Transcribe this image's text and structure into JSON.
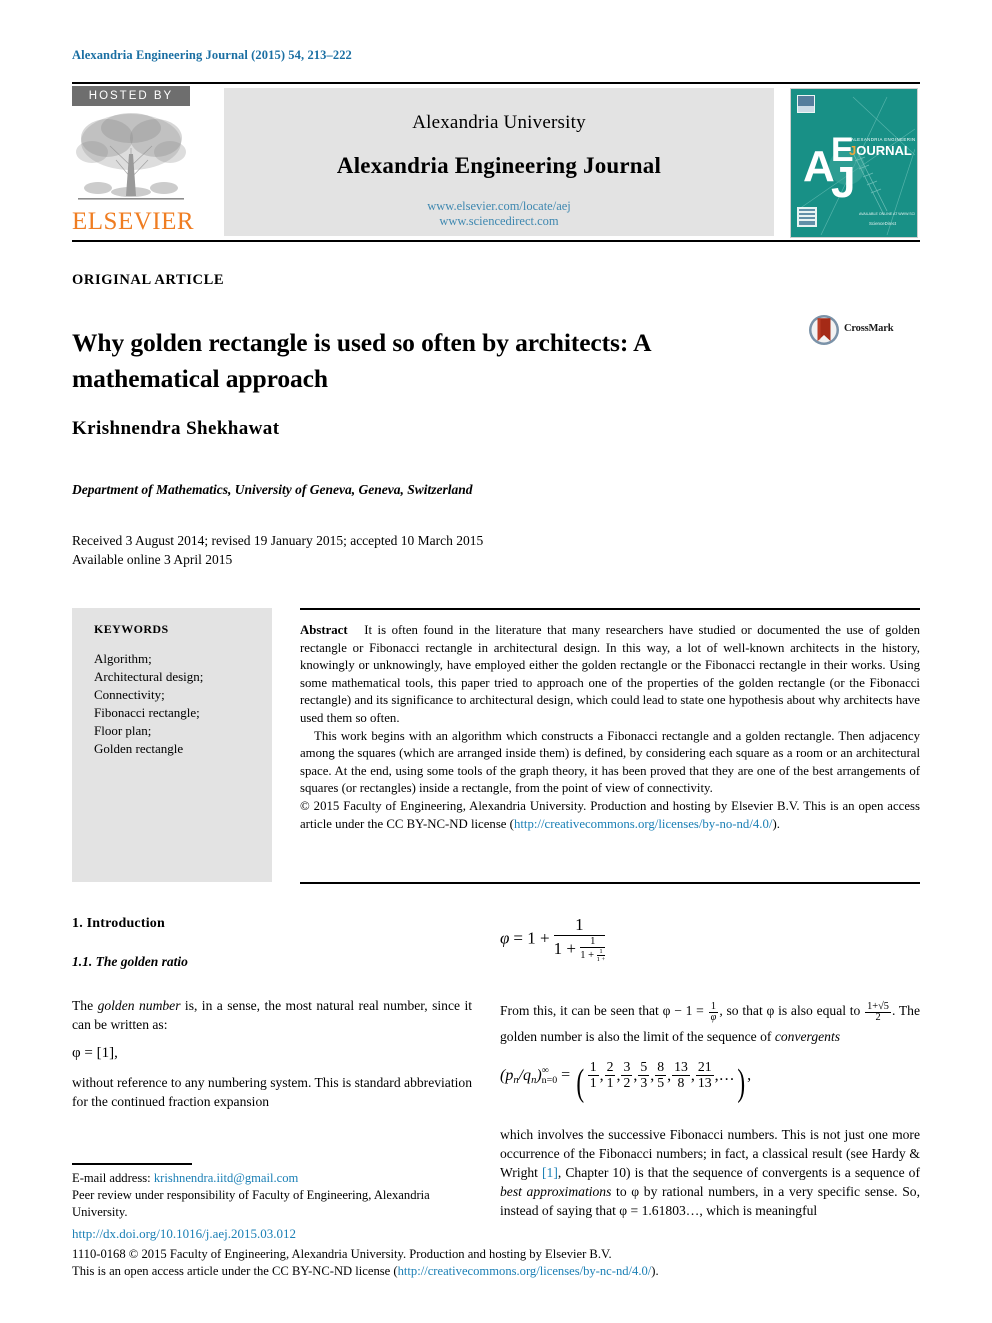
{
  "running_head": "Alexandria Engineering Journal (2015) 54, 213–222",
  "masthead": {
    "hosted_by": "HOSTED BY",
    "publisher": "ELSEVIER",
    "university": "Alexandria University",
    "journal_title": "Alexandria Engineering Journal",
    "url_locate": "www.elsevier.com/locate/aej",
    "url_sciencedirect": "www.sciencedirect.com",
    "cover_letters": "AEJ",
    "cover_word": "JOURNAL",
    "cover_subtitle": "ALEXANDRIA ENGINEERING",
    "cover_color": "#189086",
    "link_color": "#3f88b0",
    "elsevier_orange": "#ef7d22"
  },
  "article": {
    "type_label": "ORIGINAL ARTICLE",
    "title": "Why golden rectangle is used so often by architects: A mathematical approach",
    "crossmark_label": "CrossMark",
    "author": "Krishnendra Shekhawat",
    "affiliation": "Department of Mathematics, University of Geneva, Geneva, Switzerland",
    "received": "Received 3 August 2014; revised 19 January 2015; accepted 10 March 2015",
    "available": "Available online 3 April 2015"
  },
  "keywords": {
    "heading": "KEYWORDS",
    "items": [
      "Algorithm;",
      "Architectural design;",
      "Connectivity;",
      "Fibonacci rectangle;",
      "Floor plan;",
      "Golden rectangle"
    ]
  },
  "abstract": {
    "label": "Abstract",
    "para1": "It is often found in the literature that many researchers have studied or documented the use of golden rectangle or Fibonacci rectangle in architectural design. In this way, a lot of well-known architects in the history, knowingly or unknowingly, have employed either the golden rectangle or the Fibonacci rectangle in their works. Using some mathematical tools, this paper tried to approach one of the properties of the golden rectangle (or the Fibonacci rectangle) and its significance to architectural design, which could lead to state one hypothesis about why architects have used them so often.",
    "para2": "This work begins with an algorithm which constructs a Fibonacci rectangle and a golden rectangle. Then adjacency among the squares (which are arranged inside them) is defined, by considering each square as a room or an architectural space. At the end, using some tools of the graph theory, it has been proved that they are one of the best arrangements of squares (or rectangles) inside a rectangle, from the point of view of connectivity.",
    "rights_prefix": "© 2015 Faculty of Engineering, Alexandria University. Production and hosting by Elsevier B.V. This is an open access article under the CC BY-NC-ND license (",
    "rights_link": "http://creativecommons.org/licenses/by-no-nd/4.0/",
    "rights_suffix": ")."
  },
  "sections": {
    "intro_heading": "1. Introduction",
    "sub_heading": "1.1. The golden ratio",
    "left_p1_pre": "The ",
    "left_p1_em": "golden number",
    "left_p1_post": " is, in a sense, the most natural real number, since it can be written as:",
    "eq_phi_bracket": "φ = [1],",
    "left_p2": "without reference to any numbering system. This is standard abbreviation for the continued fraction expansion",
    "eq_cf_phi": "φ",
    "eq_cf_equals": "= 1 +",
    "eq_cf_one": "1",
    "eq_cf_den_1": "1 +",
    "eq_cf_den_2": "1",
    "eq_cf_den_3": "1 +",
    "eq_cf_den_4": "1",
    "eq_cf_den_5": "1 +",
    "right_p1_a": "From this, it can be seen that φ − 1 =",
    "right_p1_b": ", so that φ is also equal to",
    "right_p1_c": ". The golden number is also the limit of the sequence of ",
    "right_p1_em": "convergents",
    "eq_conv_lhs": "(p",
    "eq_conv_lhs_sub1": "n",
    "eq_conv_lhs_mid": "/q",
    "eq_conv_lhs_sub2": "n",
    "eq_conv_lhs_close": ")",
    "eq_conv_sup": "∞",
    "eq_conv_sub": "n=0",
    "eq_conv_eq": "=",
    "eq_conv_tail": ",",
    "eq_conv_dots": "…",
    "right_p2_a": "which involves the successive Fibonacci numbers. This is not just one more occurrence of the Fibonacci numbers; in fact, a classical result (see Hardy & Wright ",
    "right_p2_ref": "[1]",
    "right_p2_b": ", Chapter 10) is that the sequence of convergents is a sequence of ",
    "right_p2_em": "best approximations",
    "right_p2_c": " to φ by rational numbers, in a very specific sense. So, instead of saying that φ = 1.61803…, which is meaningful"
  },
  "convergents": {
    "numerators": [
      "1",
      "2",
      "3",
      "5",
      "8",
      "13",
      "21"
    ],
    "denominators": [
      "1",
      "1",
      "2",
      "3",
      "5",
      "8",
      "13"
    ]
  },
  "footer": {
    "email_label": "E-mail address: ",
    "email": "krishnendra.iitd@gmail.com",
    "peer_review": "Peer review under responsibility of Faculty of Engineering, Alexandria University.",
    "doi": "http://dx.doi.org/10.1016/j.aej.2015.03.012",
    "issn_line": "1110-0168 © 2015 Faculty of Engineering, Alexandria University. Production and hosting by Elsevier B.V.",
    "license_prefix": "This is an open access article under the CC BY-NC-ND license (",
    "license_link": "http://creativecommons.org/licenses/by-nc-nd/4.0/",
    "license_suffix": ")."
  }
}
